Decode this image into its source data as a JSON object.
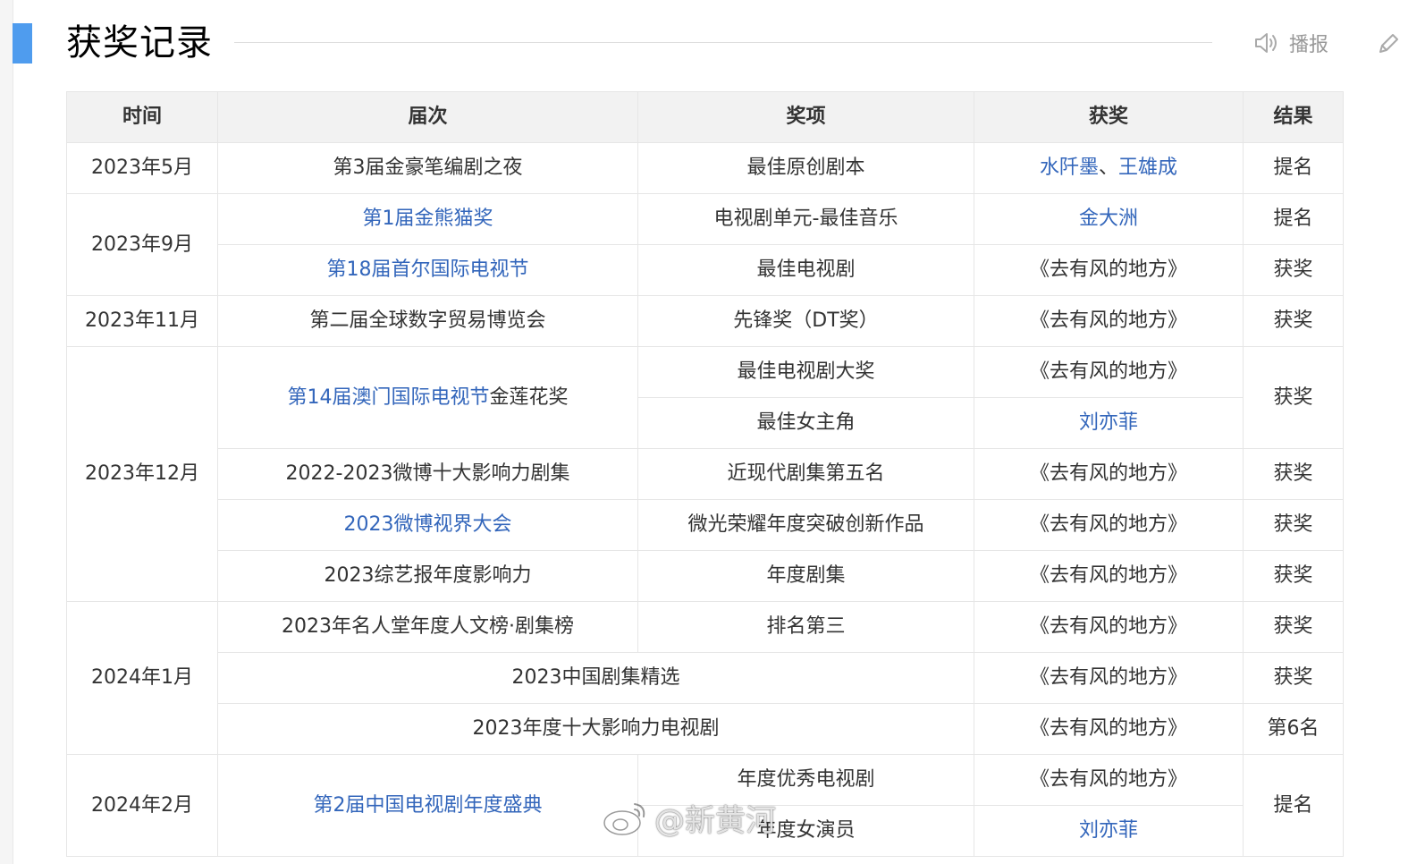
{
  "section": {
    "title": "获奖记录",
    "broadcast_label": "播报",
    "accent_color": "#4f9cee"
  },
  "table": {
    "headers": [
      "时间",
      "届次",
      "奖项",
      "获奖",
      "结果"
    ],
    "cells": {
      "r1": {
        "time": "2023年5月",
        "session": "第3届金豪笔编剧之夜",
        "award": "最佳原创剧本",
        "winner_a": "水阡墨",
        "winner_sep": "、",
        "winner_b": "王雄成",
        "result": "提名"
      },
      "r2": {
        "time": "2023年9月",
        "session": "第1届金熊猫奖",
        "award": "电视剧单元-最佳音乐",
        "winner": "金大洲",
        "result": "提名"
      },
      "r3": {
        "session": "第18届首尔国际电视节",
        "award": "最佳电视剧",
        "winner": "《去有风的地方》",
        "result": "获奖"
      },
      "r4": {
        "time": "2023年11月",
        "session": "第二届全球数字贸易博览会",
        "award": "先锋奖（DT奖）",
        "winner": "《去有风的地方》",
        "result": "获奖"
      },
      "r5": {
        "time": "2023年12月",
        "session_link": "第14届澳门国际电视节",
        "session_rest": "金莲花奖",
        "award": "最佳电视剧大奖",
        "winner": "《去有风的地方》",
        "result": "获奖"
      },
      "r6": {
        "award": "最佳女主角",
        "winner": "刘亦菲"
      },
      "r7": {
        "session": "2022-2023微博十大影响力剧集",
        "award": "近现代剧集第五名",
        "winner": "《去有风的地方》",
        "result": "获奖"
      },
      "r8": {
        "session": "2023微博视界大会",
        "award": "微光荣耀年度突破创新作品",
        "winner": "《去有风的地方》",
        "result": "获奖"
      },
      "r9": {
        "session": "2023综艺报年度影响力",
        "award": "年度剧集",
        "winner": "《去有风的地方》",
        "result": "获奖"
      },
      "r10": {
        "time": "2024年1月",
        "session": "2023年名人堂年度人文榜·剧集榜",
        "award": "排名第三",
        "winner": "《去有风的地方》",
        "result": "获奖"
      },
      "r11": {
        "session": "2023中国剧集精选",
        "winner": "《去有风的地方》",
        "result": "获奖"
      },
      "r12": {
        "session": "2023年度十大影响力电视剧",
        "winner": "《去有风的地方》",
        "result": "第6名"
      },
      "r13": {
        "time": "2024年2月",
        "session": "第2届中国电视剧年度盛典",
        "award": "年度优秀电视剧",
        "winner": "《去有风的地方》",
        "result": "提名"
      },
      "r14": {
        "award": "年度女演员",
        "winner": "刘亦菲"
      }
    },
    "link_color": "#3366bb"
  },
  "watermark": {
    "text": "@新黄河"
  }
}
